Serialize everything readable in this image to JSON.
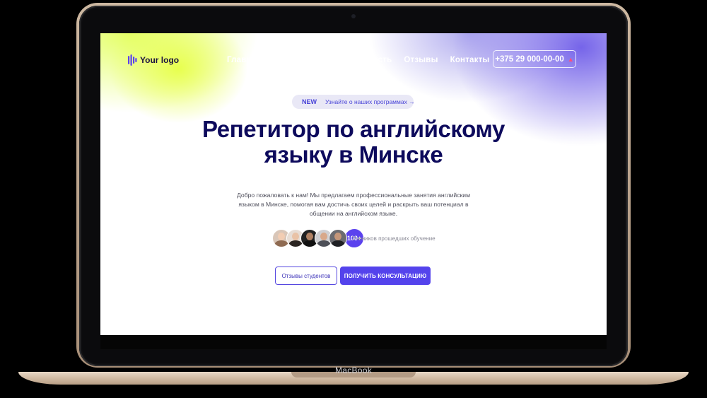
{
  "device": {
    "brand_label": "MacBook"
  },
  "site": {
    "logo_text": "Your logo",
    "nav": {
      "items": [
        "Главная",
        "Преимущества",
        "Стоимость",
        "Отзывы",
        "Контакты"
      ],
      "phone": "+375 29 000-00-00"
    },
    "badge": {
      "tag": "NEW",
      "link": "Узнайте о наших программах →"
    },
    "hero": {
      "title": "Репетитор по английскому языку в Минске",
      "lead": "Добро пожаловать к нам! Мы предлагаем профессиональные занятия английским языком в Минске, помогая вам достичь своих целей и раскрыть ваш потенциал в общении на английском языке."
    },
    "students": {
      "count": "100+",
      "label": "Учеников прошедших обучение"
    },
    "buttons": {
      "reviews": "Отзывы студентов",
      "consult": "ПОЛУЧИТЬ КОНСУЛЬТАЦИЮ"
    },
    "colors": {
      "accent": "#5443ec",
      "title": "#0d0a5c",
      "gradient_yellow": "#e7ff48",
      "gradient_purple": "#6e5ce8"
    }
  }
}
